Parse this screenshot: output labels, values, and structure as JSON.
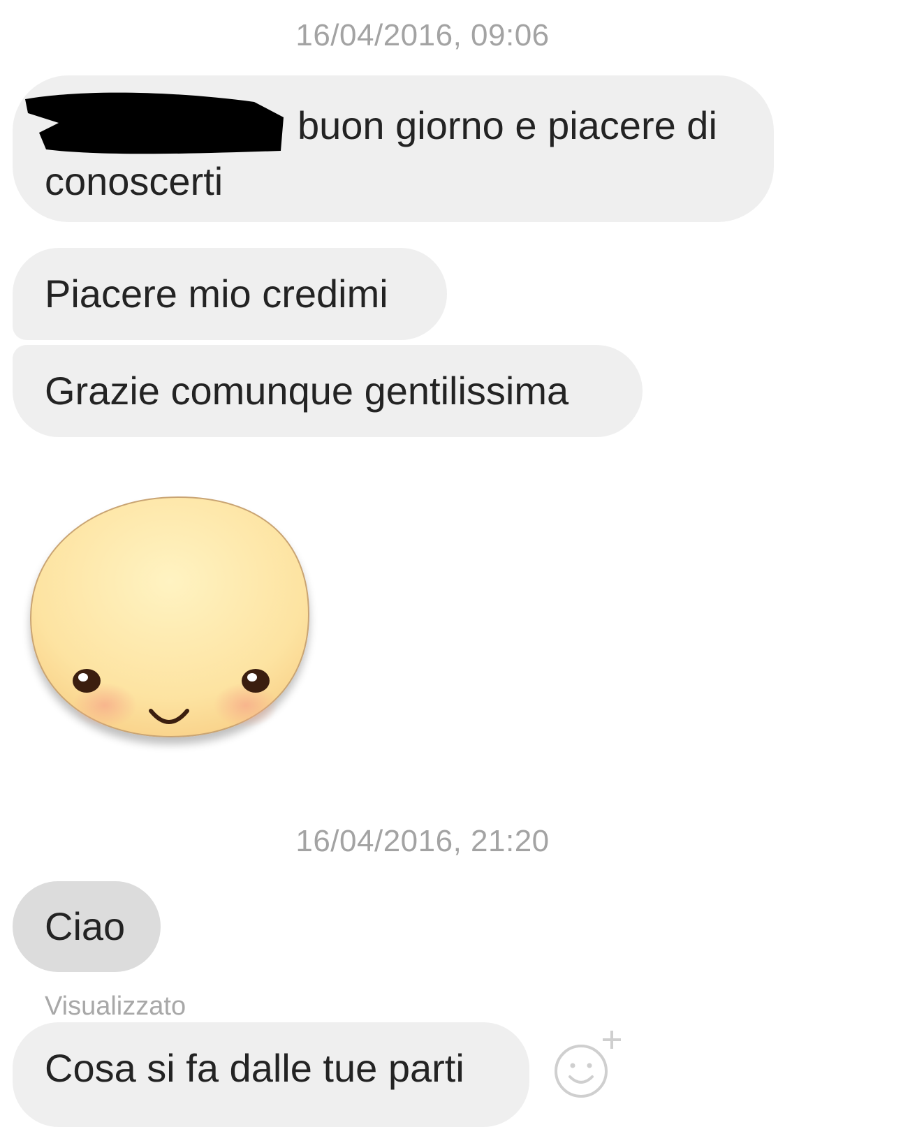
{
  "conversation": {
    "timestamp_1": "16/04/2016, 09:06",
    "timestamp_2": "16/04/2016, 21:20",
    "messages": [
      {
        "line1": "buon giorno e piacere di",
        "line2": "conoscerti"
      },
      {
        "text": "Piacere mio credimi"
      },
      {
        "text": "Grazie comunque gentilissima"
      },
      {
        "text": "Ciao"
      },
      {
        "text": "Cosa si fa dalle tue parti"
      }
    ],
    "seen_status": "Visualizzato"
  },
  "icons": {
    "sticker": "smiling-blob-face-sticker",
    "reaction": "add-reaction-smiley-icon"
  },
  "colors": {
    "bubble": "#efefef",
    "bubble_dark": "#dcdcdc",
    "timestamp": "#a3a3a3"
  }
}
